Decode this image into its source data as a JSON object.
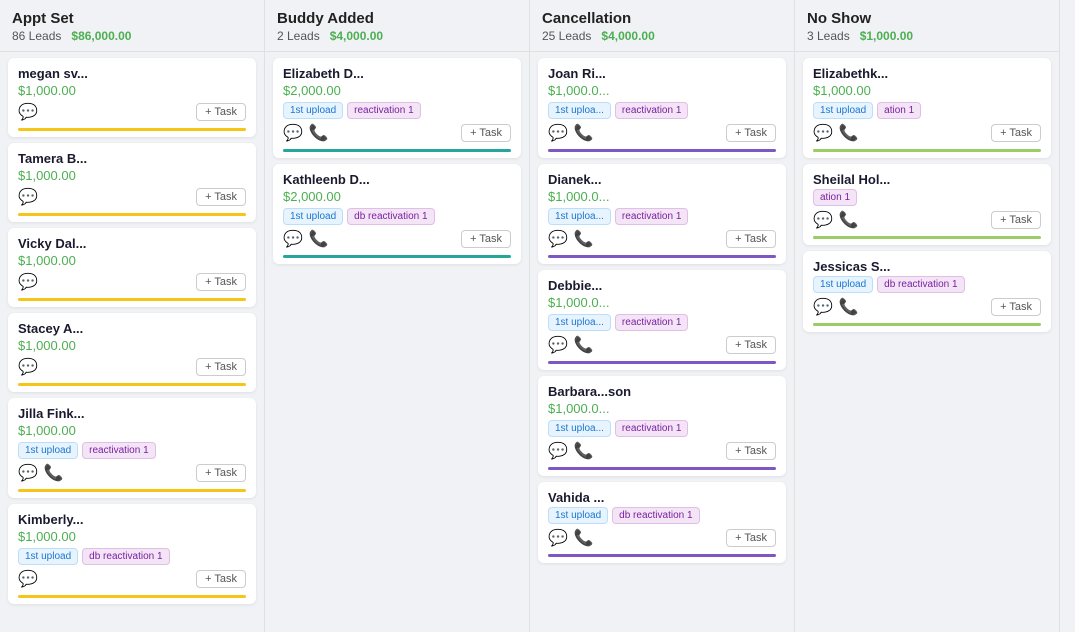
{
  "columns": [
    {
      "id": "appt-set",
      "title": "Appt Set",
      "leads_count": "86 Leads",
      "leads_amount": "$86,000.00",
      "cards": [
        {
          "name": "megan sv...",
          "amount": "$1,000.00",
          "tags": [],
          "has_chat": true,
          "has_phone": false,
          "divider": "gold"
        },
        {
          "name": "Tamera B...",
          "amount": "$1,000.00",
          "tags": [],
          "has_chat": true,
          "has_phone": false,
          "divider": "gold"
        },
        {
          "name": "Vicky Dal...",
          "amount": "$1,000.00",
          "tags": [],
          "has_chat": true,
          "has_phone": false,
          "divider": "gold"
        },
        {
          "name": "Stacey A...",
          "amount": "$1,000.00",
          "tags": [],
          "has_chat": true,
          "has_phone": false,
          "divider": "gold"
        },
        {
          "name": "Jilla Fink...",
          "amount": "$1,000.00",
          "tags": [
            {
              "label": "1st upload",
              "type": "upload"
            },
            {
              "label": "reactivation 1",
              "type": "reactivation"
            }
          ],
          "has_chat": true,
          "has_phone": true,
          "divider": "gold"
        },
        {
          "name": "Kimberly...",
          "amount": "$1,000.00",
          "tags": [
            {
              "label": "1st upload",
              "type": "upload"
            },
            {
              "label": "db reactivation 1",
              "type": "db"
            }
          ],
          "has_chat": true,
          "has_phone": false,
          "divider": "gold"
        }
      ]
    },
    {
      "id": "buddy-added",
      "title": "Buddy Added",
      "leads_count": "2 Leads",
      "leads_amount": "$4,000.00",
      "cards": [
        {
          "name": "Elizabeth D...",
          "amount": "$2,000.00",
          "tags": [
            {
              "label": "1st upload",
              "type": "upload"
            },
            {
              "label": "reactivation 1",
              "type": "reactivation"
            }
          ],
          "has_chat": true,
          "has_phone": true,
          "divider": "teal"
        },
        {
          "name": "Kathleenb D...",
          "amount": "$2,000.00",
          "tags": [
            {
              "label": "1st upload",
              "type": "upload"
            },
            {
              "label": "db reactivation 1",
              "type": "db"
            }
          ],
          "has_chat": true,
          "has_phone": true,
          "divider": "teal"
        }
      ]
    },
    {
      "id": "cancellation",
      "title": "Cancellation",
      "leads_count": "25 Leads",
      "leads_amount": "$4,000.00",
      "cards": [
        {
          "name": "Joan Ri...",
          "amount": "$1,000.0...",
          "tags": [
            {
              "label": "1st uploa...",
              "type": "upload"
            },
            {
              "label": "reactivation 1",
              "type": "reactivation"
            }
          ],
          "has_chat": true,
          "has_phone": true,
          "divider": "purple"
        },
        {
          "name": "Dianek...",
          "amount": "$1,000.0...",
          "tags": [
            {
              "label": "1st uploa...",
              "type": "upload"
            },
            {
              "label": "reactivation 1",
              "type": "reactivation"
            }
          ],
          "has_chat": true,
          "has_phone": true,
          "divider": "purple"
        },
        {
          "name": "Debbie...",
          "amount": "$1,000.0...",
          "tags": [
            {
              "label": "1st uploa...",
              "type": "upload"
            },
            {
              "label": "reactivation 1",
              "type": "reactivation"
            }
          ],
          "has_chat": true,
          "has_phone": true,
          "divider": "purple"
        },
        {
          "name": "Barbara...son",
          "amount": "$1,000.0...",
          "tags": [
            {
              "label": "1st uploa...",
              "type": "upload"
            },
            {
              "label": "reactivation 1",
              "type": "reactivation"
            }
          ],
          "has_chat": true,
          "has_phone": true,
          "divider": "purple"
        },
        {
          "name": "Vahida ...",
          "amount": "",
          "tags": [
            {
              "label": "1st upload",
              "type": "upload"
            },
            {
              "label": "db reactivation 1",
              "type": "db"
            }
          ],
          "has_chat": true,
          "has_phone": true,
          "divider": "purple"
        }
      ]
    },
    {
      "id": "no-show",
      "title": "No Show",
      "leads_count": "3 Leads",
      "leads_amount": "$1,000.00",
      "cards": [
        {
          "name": "Elizabethk...",
          "amount": "$1,000.00",
          "tags": [
            {
              "label": "1st upload",
              "type": "upload"
            },
            {
              "label": "ation 1",
              "type": "reactivation"
            }
          ],
          "has_chat": true,
          "has_phone": true,
          "divider": "olive"
        },
        {
          "name": "Sheilal Hol...",
          "amount": "",
          "tags": [
            {
              "label": "ation 1",
              "type": "reactivation"
            }
          ],
          "has_chat": true,
          "has_phone": true,
          "divider": "olive"
        },
        {
          "name": "Jessicas S...",
          "amount": "",
          "tags": [
            {
              "label": "1st upload",
              "type": "upload"
            },
            {
              "label": "db reactivation 1",
              "type": "db"
            }
          ],
          "has_chat": true,
          "has_phone": true,
          "divider": "olive"
        }
      ]
    }
  ],
  "labels": {
    "add_task": "+ Task"
  }
}
